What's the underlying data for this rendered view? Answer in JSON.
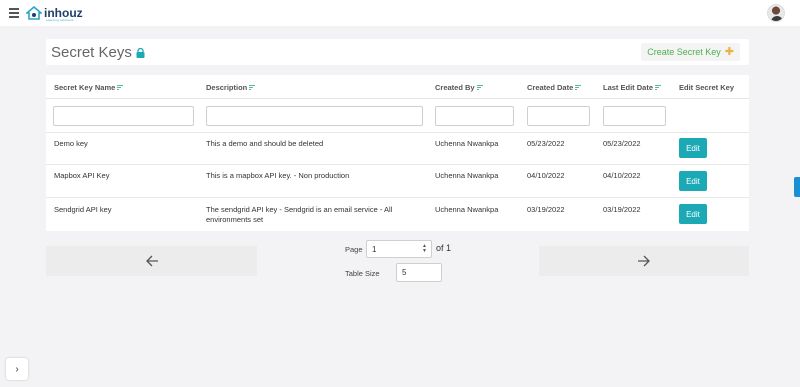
{
  "app": {
    "logo_text": "inhouz",
    "logo_subtext": "sourcing solutions"
  },
  "header": {
    "title": "Secret Keys",
    "create_button": "Create Secret Key"
  },
  "table": {
    "columns": [
      "Secret Key Name",
      "Description",
      "Created By",
      "Created Date",
      "Last Edit Date",
      "Edit Secret Key"
    ],
    "rows": [
      {
        "name": "Demo key",
        "description": "This a demo and should be deleted",
        "created_by": "Uchenna Nwankpa",
        "created_date": "05/23/2022",
        "last_edit": "05/23/2022",
        "edit": "Edit"
      },
      {
        "name": "Mapbox API Key",
        "description": "This is a mapbox API key. - Non production",
        "created_by": "Uchenna Nwankpa",
        "created_date": "04/10/2022",
        "last_edit": "04/10/2022",
        "edit": "Edit"
      },
      {
        "name": "Sendgrid API key",
        "description": "The sendgrid API key - Sendgrid is an email service - All environments set",
        "created_by": "Uchenna Nwankpa",
        "created_date": "03/19/2022",
        "last_edit": "03/19/2022",
        "edit": "Edit"
      }
    ]
  },
  "pagination": {
    "page_label": "Page",
    "page_value": "1",
    "of_text": "of 1",
    "table_size_label": "Table Size",
    "table_size_value": "5"
  },
  "colors": {
    "accent": "#1ba9b6",
    "create_text": "#4caf50"
  }
}
